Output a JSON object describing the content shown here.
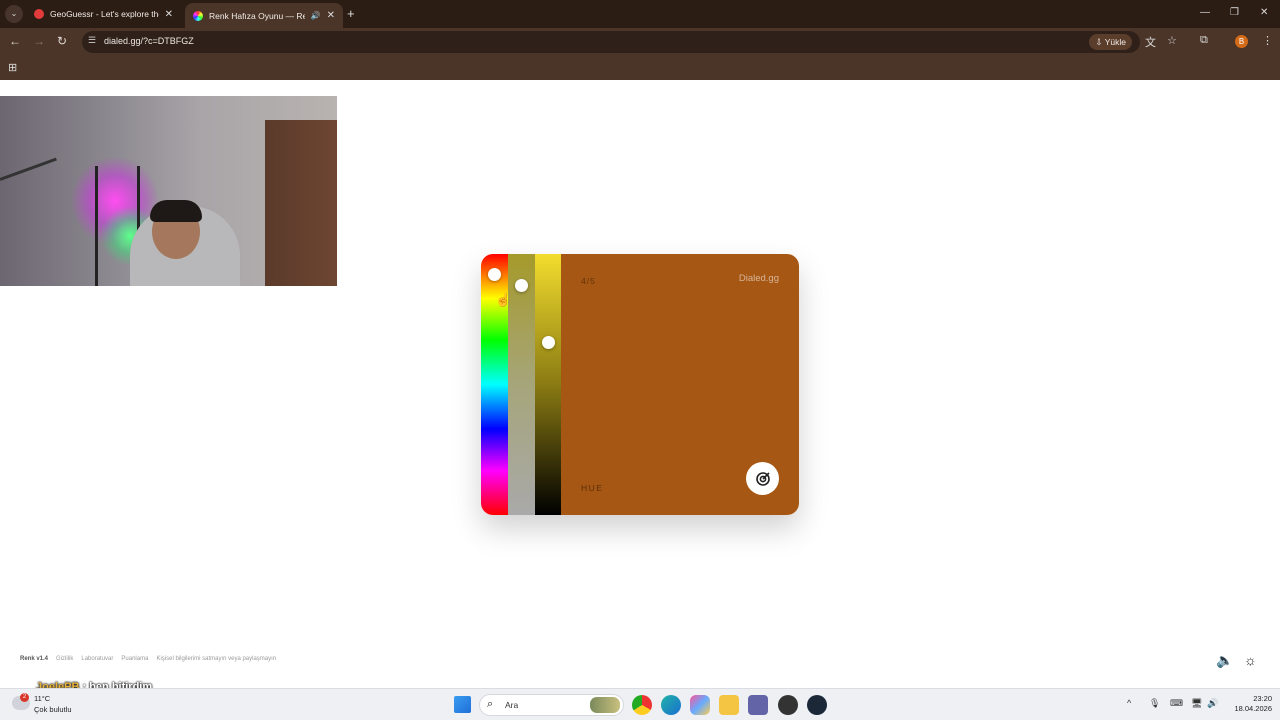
{
  "browser": {
    "tabs": [
      {
        "title": "GeoGuessr - Let's explore the w",
        "icon": "map-pin-icon",
        "active": false
      },
      {
        "title": "Renk Hafıza Oyunu — Renk",
        "icon": "color-wheel-icon",
        "active": true
      }
    ],
    "url": "dialed.gg/?c=DTBFGZ",
    "install_label": "Yükle",
    "profile_initial": "B"
  },
  "game": {
    "counter": "4/5",
    "brand": "Dialed.gg",
    "mode": "HUE",
    "color": "#a65714",
    "sliders": {
      "hue": 0.08,
      "saturation": 0.12,
      "lightness": 0.34
    }
  },
  "footer": {
    "version": "Renk v1.4",
    "links": [
      "Gizlilik",
      "Laboratuvar",
      "Puanlama",
      "Kişisel bilgilerimi satmayın veya paylaşmayın"
    ]
  },
  "chat": {
    "user": "JoelePB",
    "message": ": ben bitirdim"
  },
  "taskbar": {
    "weather": {
      "temp": "11°C",
      "condition": "Çok bulutlu",
      "badge": "2"
    },
    "search_placeholder": "Ara",
    "time": "23:20",
    "date": "18.04.2026"
  },
  "colors": {
    "titlebar": "#2b1c14",
    "toolbar": "#4a3528",
    "accent": "#d46b19"
  }
}
